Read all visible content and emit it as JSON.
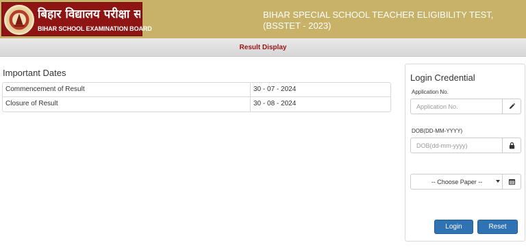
{
  "header": {
    "logo_hindi": "बिहार विद्यालय परीक्षा समिति",
    "logo_english": "BIHAR SCHOOL EXAMINATION BOARD",
    "title_line1": "BIHAR SPECIAL SCHOOL TEACHER ELIGIBILITY TEST,",
    "title_line2": "(BSSTET - 2023)",
    "brand_color": "#c8b268",
    "logo_color": "#8f1414"
  },
  "subbar": {
    "title": "Result Display",
    "title_color": "#9a1414"
  },
  "important_dates": {
    "heading": "Important Dates",
    "rows": [
      {
        "label": "Commencement of Result",
        "value": "30 - 07 - 2024"
      },
      {
        "label": "Closure of Result",
        "value": "30 - 08 - 2024"
      }
    ]
  },
  "login": {
    "title": "Login Credential",
    "application_label": "Application No.",
    "application_placeholder": "Application No.",
    "application_icon": "pencil-icon",
    "dob_label": "DOB(DD-MM-YYYY)",
    "dob_placeholder": "DOB(dd-mm-yyyy)",
    "dob_icon": "lock-icon",
    "paper_selected": "-- Choose Paper --",
    "paper_icon": "calendar-icon",
    "login_button": "Login",
    "reset_button": "Reset",
    "button_color": "#2f73b4"
  }
}
